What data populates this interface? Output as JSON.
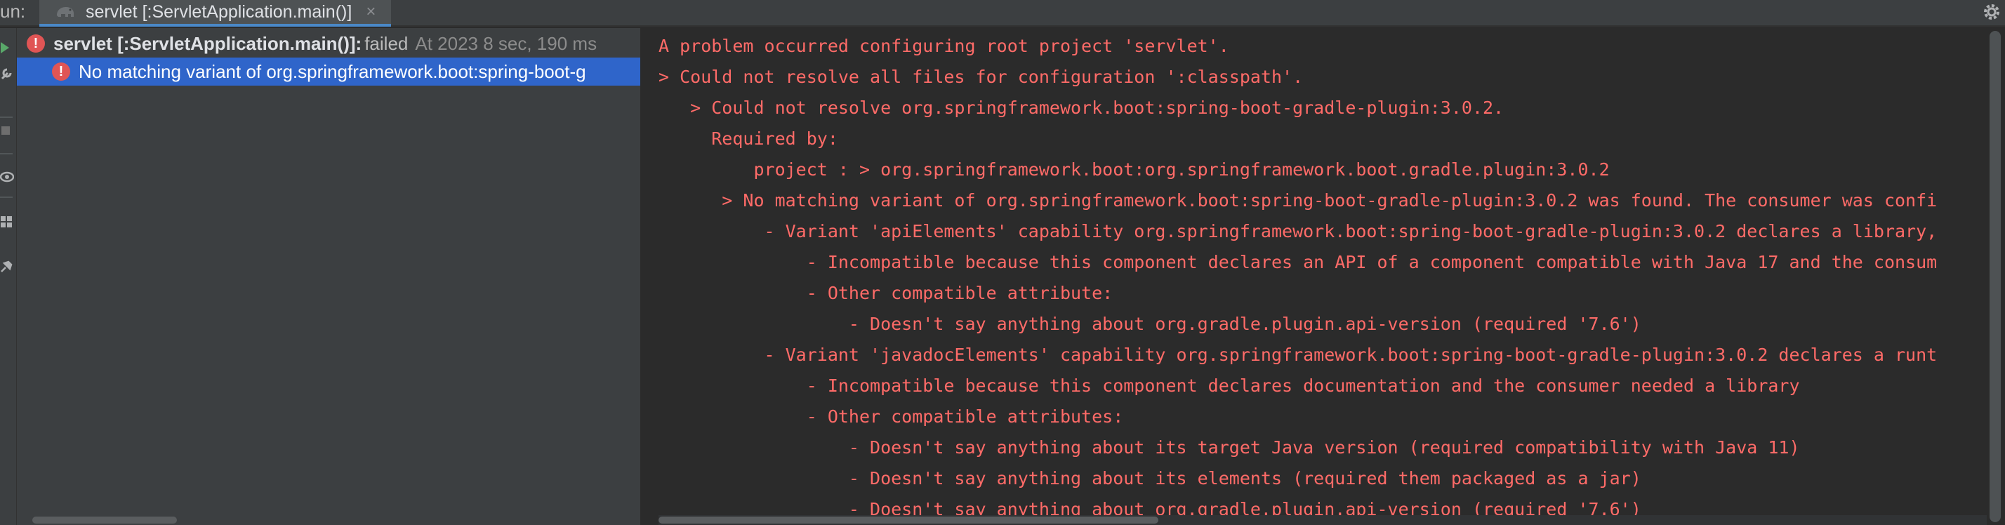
{
  "header": {
    "run_label": "un:",
    "tab_label": "servlet [:ServletApplication.main()]",
    "tab_close": "×"
  },
  "toolbar": {
    "icons": [
      "run-icon",
      "wrench-icon",
      "stop-icon",
      "eye-icon",
      "layout-icon",
      "pin-icon"
    ]
  },
  "tree": {
    "root": {
      "name": "servlet [:ServletApplication.main()]:",
      "status": "failed",
      "time": "At 2023 8 sec, 190 ms"
    },
    "child": {
      "text": "No matching variant of org.springframework.boot:spring-boot-g"
    }
  },
  "console": {
    "lines": [
      "A problem occurred configuring root project 'servlet'.",
      "> Could not resolve all files for configuration ':classpath'.",
      "   > Could not resolve org.springframework.boot:spring-boot-gradle-plugin:3.0.2.",
      "     Required by:",
      "         project : > org.springframework.boot:org.springframework.boot.gradle.plugin:3.0.2",
      "      > No matching variant of org.springframework.boot:spring-boot-gradle-plugin:3.0.2 was found. The consumer was confi",
      "          - Variant 'apiElements' capability org.springframework.boot:spring-boot-gradle-plugin:3.0.2 declares a library,",
      "              - Incompatible because this component declares an API of a component compatible with Java 17 and the consum",
      "              - Other compatible attribute:",
      "                  - Doesn't say anything about org.gradle.plugin.api-version (required '7.6')",
      "          - Variant 'javadocElements' capability org.springframework.boot:spring-boot-gradle-plugin:3.0.2 declares a runt",
      "              - Incompatible because this component declares documentation and the consumer needed a library",
      "              - Other compatible attributes:",
      "                  - Doesn't say anything about its target Java version (required compatibility with Java 11)",
      "                  - Doesn't say anything about its elements (required them packaged as a jar)",
      "                  - Doesn't say anything about org.gradle.plugin.api-version (required '7.6')"
    ]
  },
  "colors": {
    "error_text": "#ff6b68",
    "selection": "#2f65ca",
    "error_icon": "#e05555"
  }
}
